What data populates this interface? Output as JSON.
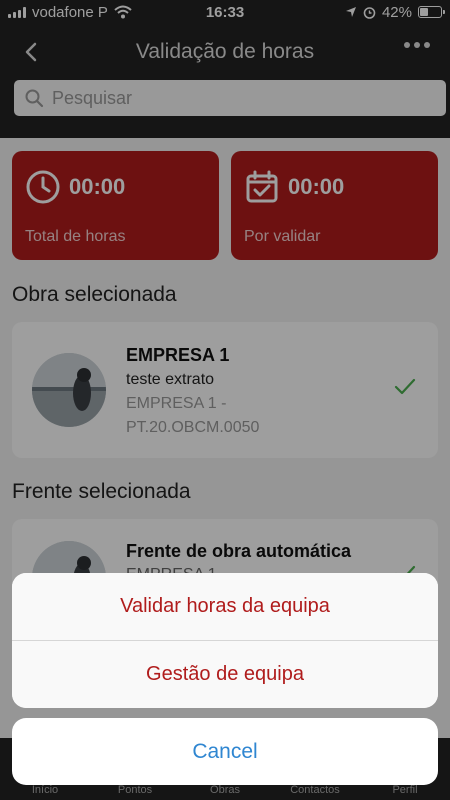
{
  "status_bar": {
    "carrier": "vodafone P",
    "time": "16:33",
    "battery": "42%",
    "battery_level": 0.42
  },
  "header": {
    "title": "Validação de horas",
    "back_icon": "chevron-left-icon",
    "more_icon": "ellipsis-icon"
  },
  "search": {
    "placeholder": "Pesquisar"
  },
  "summary": {
    "total": {
      "value": "00:00",
      "label": "Total de horas",
      "icon": "clock-icon"
    },
    "pending": {
      "value": "00:00",
      "label": "Por validar",
      "icon": "calendar-check-icon"
    }
  },
  "obra": {
    "section_title": "Obra selecionada",
    "title": "EMPRESA 1",
    "subtitle": "teste extrato",
    "meta": "EMPRESA 1 - PT.20.OBCM.0050"
  },
  "frente": {
    "section_title": "Frente selecionada",
    "title": "Frente de obra automática",
    "subtitle": "EMPRESA 1"
  },
  "tab_bar": {
    "items": [
      "Início",
      "Pontos",
      "Obras",
      "Contactos",
      "Perfil"
    ]
  },
  "action_sheet": {
    "validate_label": "Validar horas da equipa",
    "team_label": "Gestão de equipa",
    "cancel_label": "Cancel"
  },
  "colors": {
    "accent": "#b01c1c",
    "header_bg": "#222222",
    "cancel": "#2f86d1",
    "check": "#4caf50"
  }
}
